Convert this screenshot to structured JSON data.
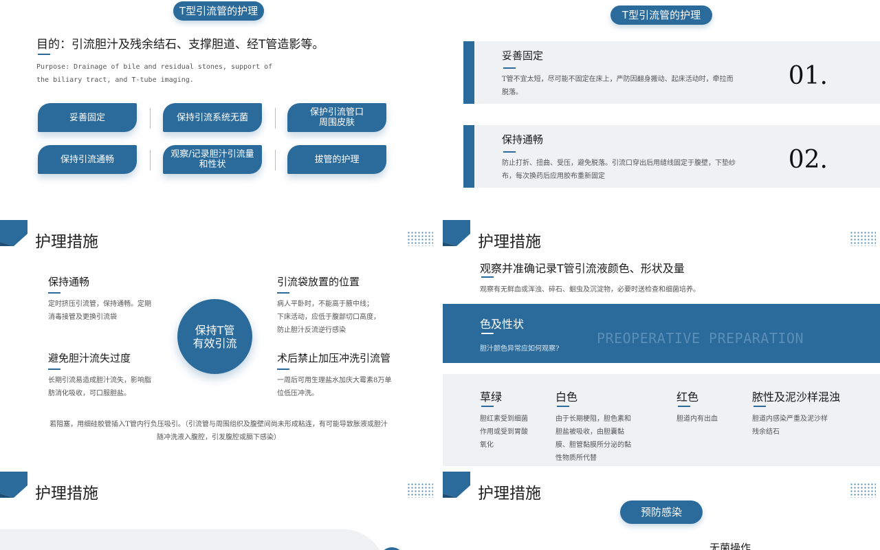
{
  "slide1": {
    "pill": "T型引流管的护理",
    "goal": "目的：引流胆汁及残余结石、支撑胆道、经T管造影等。",
    "purpose": "Purpose: Drainage of bile and residual stones, support of the biliary tract, and T-tube imaging.",
    "tiles": [
      {
        "label": "妥善固定"
      },
      {
        "label": "保持引流系统无菌"
      },
      {
        "label": "保护引流管口\n周围皮肤"
      },
      {
        "label": "保持引流通畅"
      },
      {
        "label": "观察/记录胆汁引流量\n和性状"
      },
      {
        "label": "拔管的护理"
      }
    ]
  },
  "slide2": {
    "pill": "T型引流管的护理",
    "cards": [
      {
        "title": "妥善固定",
        "body": "T管不宜太短，尽可能不固定在床上，严防因翻身搬动、起床活动时，牵拉而脱落。",
        "num": "01."
      },
      {
        "title": "保持通畅",
        "body": "防止打折、扭曲、受压，避免脱落。引流口穿出后用缝线固定于腹壁，下垫纱布，每次换药后应用胶布重新固定",
        "num": "02."
      }
    ]
  },
  "slide3": {
    "header": "护理措施",
    "center": "保持T管\n有效引流",
    "blocks": [
      {
        "title": "保持通畅",
        "body": "定时挤压引流管，保持通畅。定期消毒接管及更换引流袋"
      },
      {
        "title": "避免胆汁流失过度",
        "body": "长期引流易造成胆汁流失，影响脂肪消化吸收，可口服胆盐。"
      },
      {
        "title": "引流袋放置的位置",
        "body": "病人平卧时，不能高于腋中线；\n下床活动，应低于腹部切口高度，\n防止胆汁反流逆行感染"
      },
      {
        "title": "术后禁止加压冲洗引流管",
        "body": "一周后可用生理盐水加庆大霉素8万单位低压冲洗。"
      }
    ],
    "note": "若阻塞，用细硅胶管插入T管内行负压吸引。（引流管与周围组织及腹壁间尚未形成粘连，有可能导致胀液或胆汁随冲洗液入腹腔，引发腹腔或膈下感染）"
  },
  "slide4": {
    "header": "护理措施",
    "title": "观察并准确记录T管引流液颜色、形状及量",
    "subtitle": "观察有无鲜血或浑浊、碎石、蛔虫及沉淀物，必要时送检查和细菌培养。",
    "band_title": "色及性状",
    "band_sub": "胆汁颜色异常应如何观察?",
    "band_watermark": "PREOPERATIVE PREPARATION",
    "colors": [
      {
        "title": "草绿",
        "body": "胆红素受到细菌作用或受到胃酸氧化"
      },
      {
        "title": "白色",
        "body": "由于长期梗阻，胆色素和胆盐被吸收，由胆囊黏膜、胆管黏膜所分泌的黏性物质所代替"
      },
      {
        "title": "红色",
        "body": "胆道内有出血"
      },
      {
        "title": "脓性及泥沙样混浊",
        "body": "胆道内感染严重及泥沙样残余结石"
      }
    ]
  },
  "slide5": {
    "header": "护理措施"
  },
  "slide6": {
    "header": "护理措施",
    "pill": "预防感染",
    "partial": "无菌操作"
  },
  "colors": {
    "brand": "#2b6b9b",
    "card_bg": "#eff1f3"
  }
}
